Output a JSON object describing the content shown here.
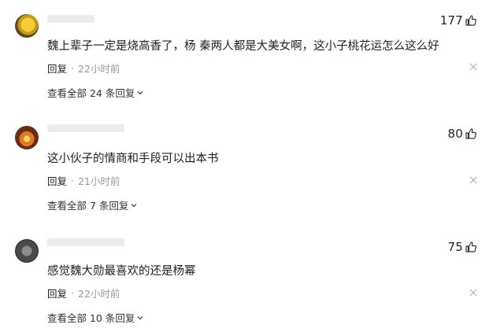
{
  "comments": [
    {
      "username": "",
      "text": "魏上辈子一定是烧高香了，杨 秦两人都是大美女啊，这小子桃花运怎么这么好",
      "likes": "177",
      "reply_label": "回复",
      "time": "22小时前",
      "view_all": "查看全部 24 条回复"
    },
    {
      "username": "",
      "text": "这小伙子的情商和手段可以出本书",
      "likes": "80",
      "reply_label": "回复",
      "time": "21小时前",
      "view_all": "查看全部 7 条回复"
    },
    {
      "username": "",
      "text": "感觉魏大勋最喜欢的还是杨幂",
      "likes": "75",
      "reply_label": "回复",
      "time": "22小时前",
      "view_all": "查看全部 10 条回复"
    }
  ],
  "separator": "·",
  "colors": {
    "meta_gray": "#999999",
    "text": "#1f1f1f"
  },
  "icons": {
    "like": "thumbs-up-icon",
    "close": "close-icon",
    "expand": "chevron-down-icon"
  }
}
